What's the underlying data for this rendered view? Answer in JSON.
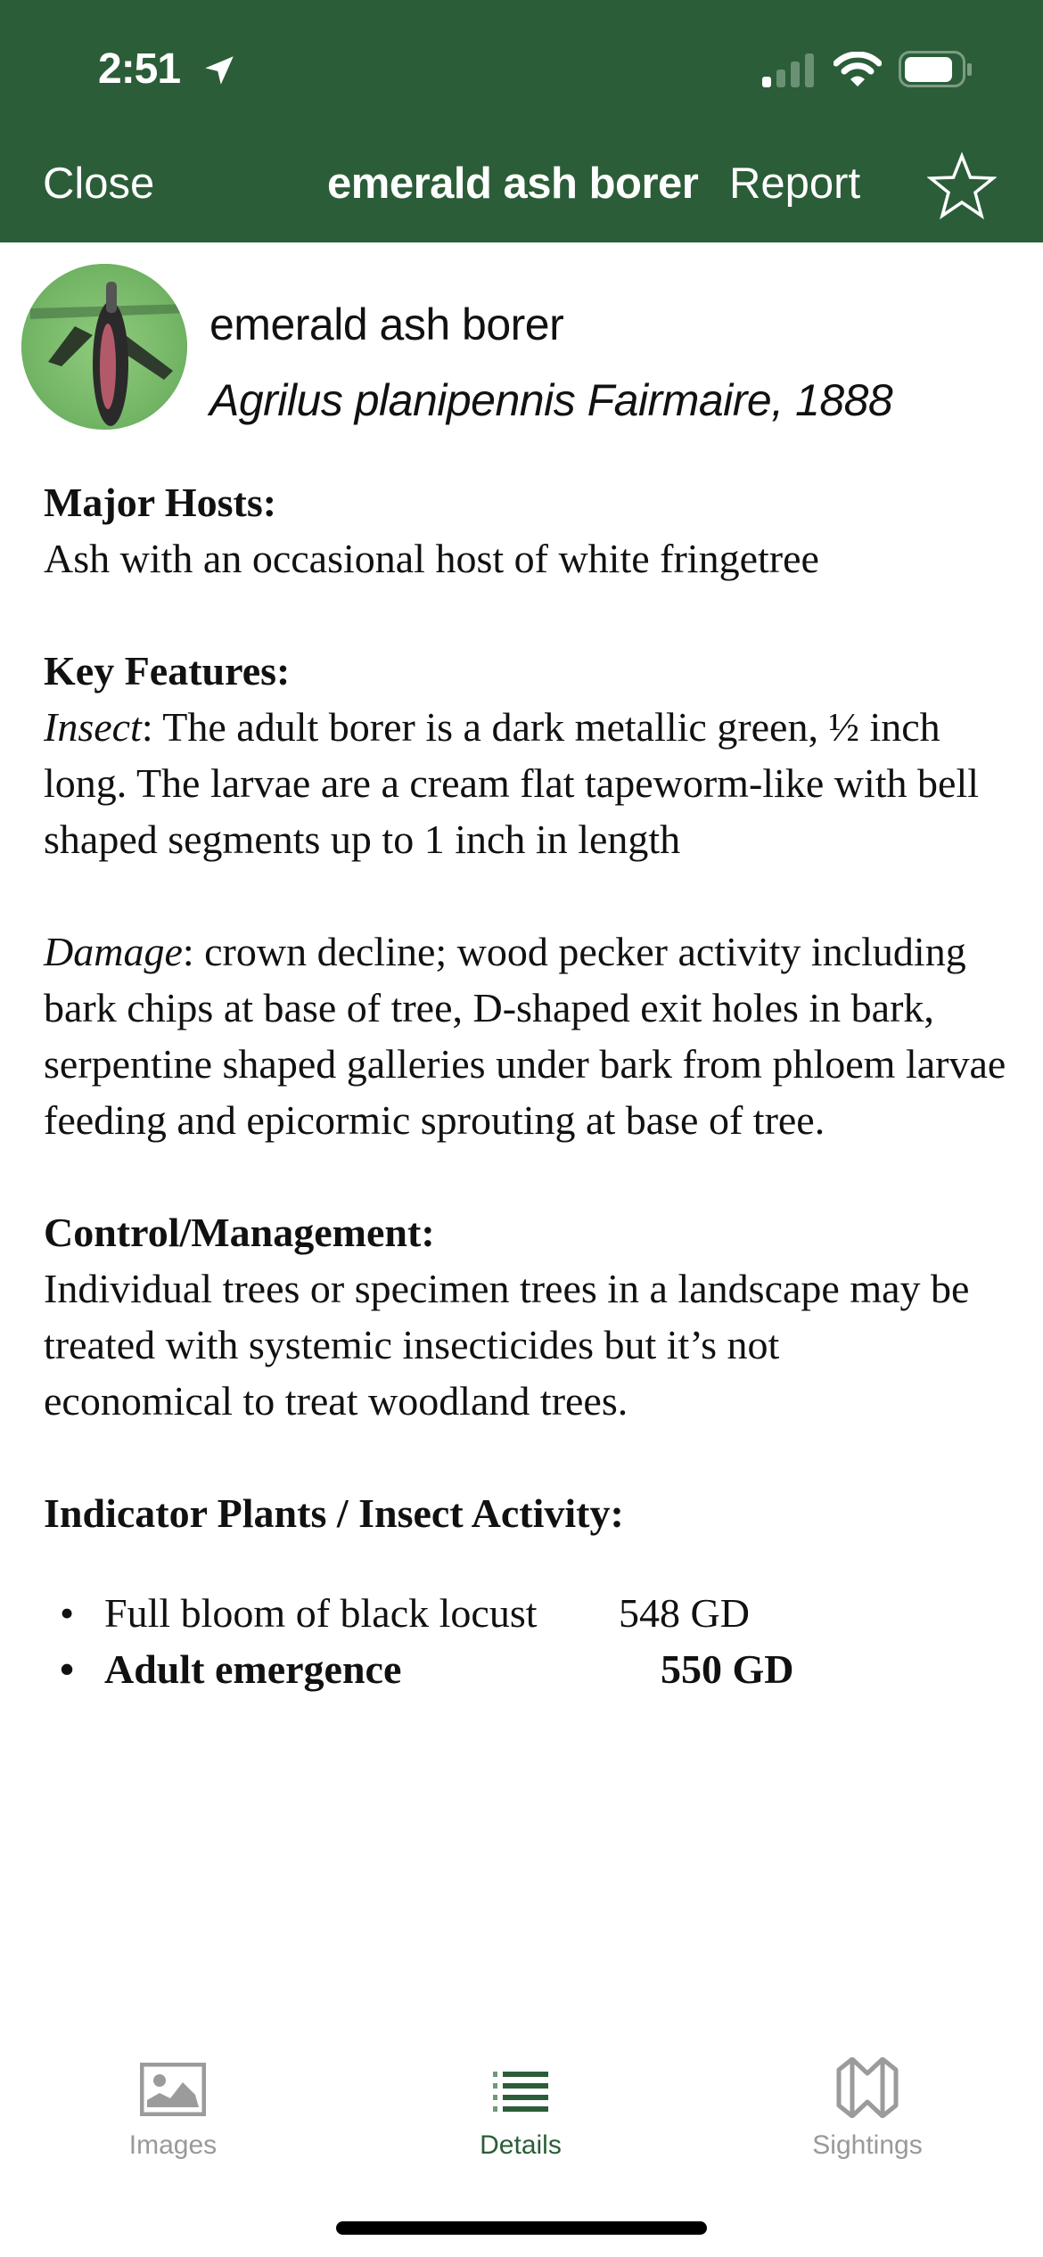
{
  "status_bar": {
    "time": "2:51",
    "location_icon": "location-arrow-icon",
    "signal_bars_active": 1,
    "signal_bars_total": 4,
    "wifi_icon": "wifi-icon",
    "battery_level_percent": 85
  },
  "nav": {
    "close_label": "Close",
    "title": "emerald ash borer",
    "report_label": "Report",
    "favorite_icon": "star-outline-icon"
  },
  "species": {
    "common_name": "emerald ash borer",
    "scientific_name": "Agrilus planipennis Fairmaire, 1888",
    "avatar_icon": "insect-photo"
  },
  "sections": {
    "major_hosts": {
      "heading": "Major Hosts:",
      "text": "Ash with an occasional host of white fringetree"
    },
    "key_features": {
      "heading": "Key Features:",
      "insect_label": "Insect",
      "insect_text": ": The adult borer is a dark metallic green, ½ inch long.  The larvae are a cream flat tapeworm-like with bell shaped segments up to 1 inch in length",
      "damage_label": "Damage",
      "damage_text": ": crown decline; wood pecker activity including bark chips at base of tree, D-shaped exit holes in bark, serpentine shaped galleries under bark from phloem larvae feeding and epicormic sprouting at base of tree."
    },
    "control": {
      "heading": "Control/Management:",
      "text": "Individual trees or specimen trees in a landscape may be treated with systemic insecticides but it’s not economical to treat woodland trees."
    },
    "indicators": {
      "heading": "Indicator Plants / Insect Activity:",
      "items": [
        {
          "label": "Full bloom of black locust",
          "value": "548 GD",
          "bold": false
        },
        {
          "label": "Adult emergence",
          "value": "550 GD",
          "bold": true
        }
      ]
    }
  },
  "tabs": [
    {
      "label": "Images",
      "icon": "image-icon",
      "active": false
    },
    {
      "label": "Details",
      "icon": "list-icon",
      "active": true
    },
    {
      "label": "Sightings",
      "icon": "map-icon",
      "active": false
    }
  ],
  "colors": {
    "brand_green": "#2b5d38",
    "inactive_tab": "#999999"
  }
}
